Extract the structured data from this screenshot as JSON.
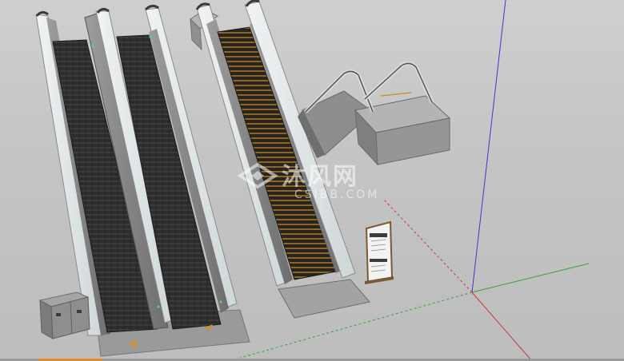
{
  "watermark": {
    "text": "沐风网",
    "subtext": "CSIBB.COM"
  },
  "scene": {
    "description_objects": [
      "double-escalator-left",
      "single-escalator-center",
      "escalator-top-landing",
      "info-sign-stand",
      "control-cabinet"
    ],
    "colors": {
      "background": "#c6c6c6",
      "steel": "#8e8e8e",
      "dark_steps": "#2f2f2f",
      "gold_steps": "#c8923a",
      "glass": "#e7eef0",
      "axis_red": "#c33",
      "axis_green": "#3a3",
      "axis_blue": "#33c"
    }
  }
}
